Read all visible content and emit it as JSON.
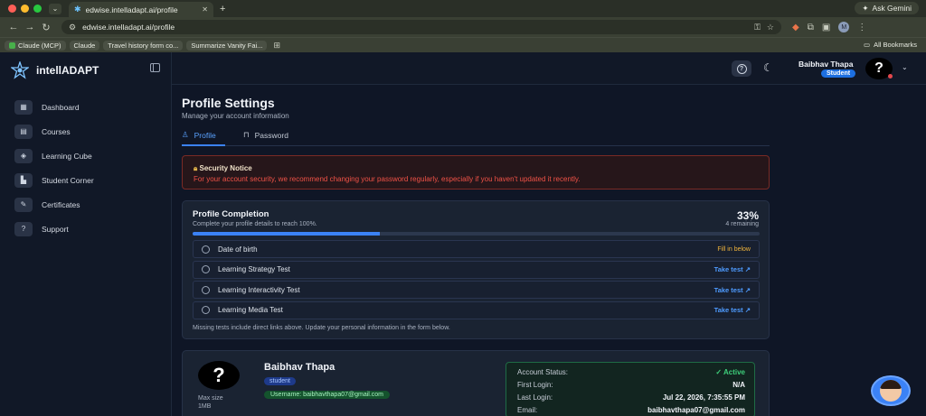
{
  "browser": {
    "tab_title": "edwise.intelladapt.ai/profile",
    "url": "edwise.intelladapt.ai/profile",
    "ask_gemini": "Ask Gemini",
    "profile_initial": "M",
    "bookmarks": [
      "Claude (MCP)",
      "Claude",
      "Travel history form co...",
      "Summarize Vanity Fai..."
    ],
    "all_bookmarks": "All Bookmarks"
  },
  "sidebar": {
    "logo": "intellADAPT",
    "items": [
      {
        "label": "Dashboard",
        "icon": "dashboard-icon"
      },
      {
        "label": "Courses",
        "icon": "courses-icon"
      },
      {
        "label": "Learning Cube",
        "icon": "cube-icon"
      },
      {
        "label": "Student Corner",
        "icon": "chart-icon"
      },
      {
        "label": "Certificates",
        "icon": "certificate-icon"
      },
      {
        "label": "Support",
        "icon": "support-icon"
      }
    ]
  },
  "topbar": {
    "user_name": "Baibhav Thapa",
    "role": "Student",
    "avatar_glyph": "?"
  },
  "page": {
    "title": "Profile Settings",
    "subtitle": "Manage your account information",
    "tabs": [
      "Profile",
      "Password"
    ]
  },
  "notice": {
    "title": "Security Notice",
    "text": "For your account security, we recommend changing your password regularly, especially if you haven't updated it recently."
  },
  "completion": {
    "title": "Profile Completion",
    "subtitle": "Complete your profile details to reach 100%.",
    "percent": "33%",
    "percent_value": 33,
    "remaining": "4 remaining",
    "items": [
      {
        "label": "Date of birth",
        "action": "Fill in below"
      },
      {
        "label": "Learning Strategy Test",
        "action": "Take test ↗"
      },
      {
        "label": "Learning Interactivity Test",
        "action": "Take test ↗"
      },
      {
        "label": "Learning Media Test",
        "action": "Take test ↗"
      }
    ],
    "footer": "Missing tests include direct links above. Update your personal information in the form below."
  },
  "profile_card": {
    "avatar_glyph": "?",
    "max_size": "Max size",
    "max_size_value": "1MB",
    "name": "Baibhav Thapa",
    "role": "student",
    "username": "Username: baibhavthapa07@gmail.com",
    "account": [
      {
        "label": "Account Status:",
        "value": "✓ Active"
      },
      {
        "label": "First Login:",
        "value": "N/A"
      },
      {
        "label": "Last Login:",
        "value": "Jul 22, 2026, 7:35:55 PM"
      },
      {
        "label": "Email:",
        "value": "baibhavthapa07@gmail.com"
      }
    ]
  },
  "colors": {
    "accent": "#3b82f6",
    "danger": "#f05247",
    "success": "#3ecf7a",
    "warning": "#f0b43c"
  }
}
